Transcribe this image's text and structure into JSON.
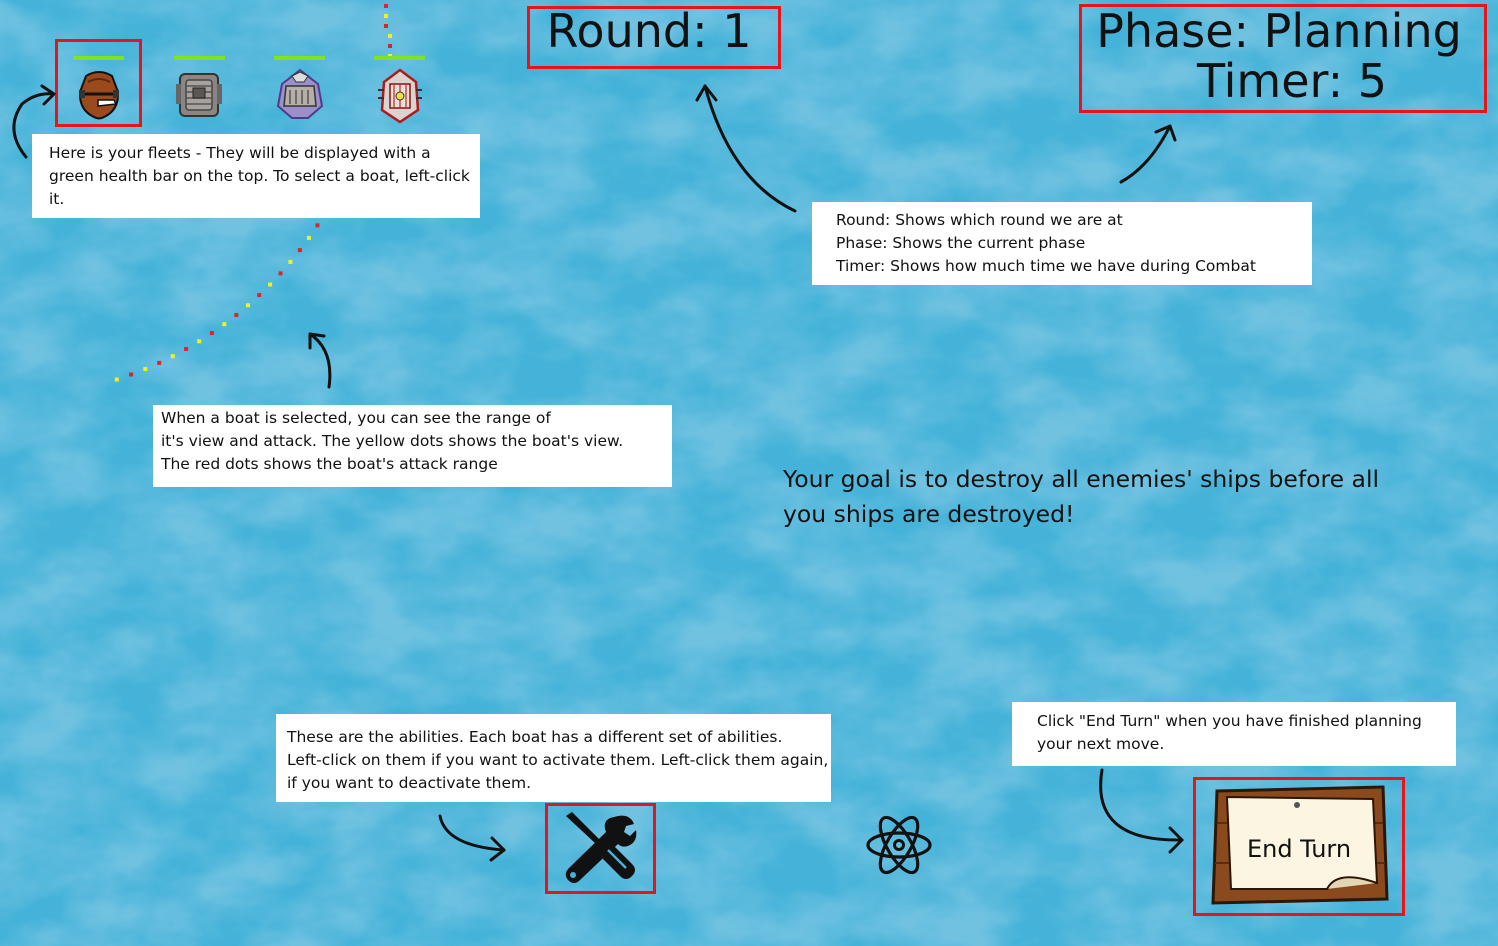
{
  "hud": {
    "round_text": "Round: 1",
    "phase_text": "Phase: Planning",
    "timer_text": "Timer: 5"
  },
  "fleet": {
    "ships": [
      {
        "name": "brown-ship",
        "health": 1.0,
        "selected": true
      },
      {
        "name": "grey-ship",
        "health": 1.0,
        "selected": false
      },
      {
        "name": "purple-ship",
        "health": 1.0,
        "selected": false
      },
      {
        "name": "red-ship",
        "health": 1.0,
        "selected": false
      }
    ]
  },
  "notes": {
    "fleet": [
      "Here is your fleets - They will be displayed with a",
      "green health bar on the top. To select a boat, left-click",
      "it."
    ],
    "hud": [
      "Round: Shows which round we are at",
      "Phase: Shows the current phase",
      "Timer: Shows how much time we have during Combat"
    ],
    "range": [
      "When a boat is selected, you can see the range of",
      "it's view and attack. The yellow dots shows the boat's view.",
      "The red dots shows the boat's attack range"
    ],
    "abilities": [
      "These are the abilities. Each boat has a different set of abilities.",
      "Left-click on them if you want to activate them. Left-click them again,",
      "if you want to deactivate them."
    ],
    "end_turn": [
      "Click \"End Turn\"  when you have finished planning",
      "your next move."
    ]
  },
  "goal": {
    "line1": "Your goal is to destroy all enemies' ships before all",
    "line2": "you ships are destroyed!"
  },
  "abilities": [
    {
      "icon": "wrench-screwdriver-icon",
      "active": true
    },
    {
      "icon": "atom-icon",
      "active": false
    }
  ],
  "end_turn": {
    "label": "End Turn"
  },
  "colors": {
    "sea": "#45b3d9",
    "highlight": "#e8141b",
    "health": "#7ee41e",
    "view_dots": "#f2f21a",
    "attack_dots": "#d8262a"
  }
}
